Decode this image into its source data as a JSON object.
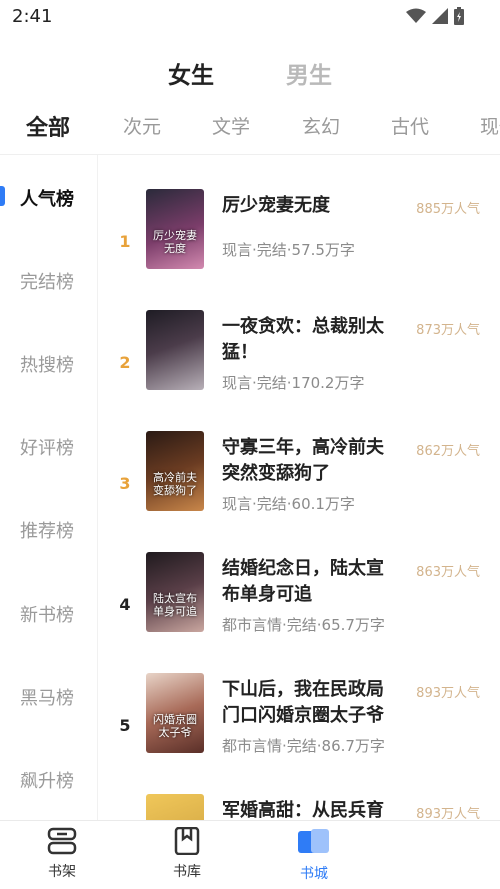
{
  "status_bar": {
    "time": "2:41"
  },
  "gender_tabs": [
    {
      "label": "女生",
      "active": true
    },
    {
      "label": "男生",
      "active": false
    }
  ],
  "category_tabs": [
    "全部",
    "次元",
    "文学",
    "玄幻",
    "古代",
    "现代"
  ],
  "sidebar": {
    "items": [
      "人气榜",
      "完结榜",
      "热搜榜",
      "好评榜",
      "推荐榜",
      "新书榜",
      "黑马榜",
      "飙升榜"
    ],
    "active_index": 0
  },
  "books": [
    {
      "rank": "1",
      "title": "厉少宠妻无度",
      "meta": "现言·完结·57.5万字",
      "popularity": "885万人气",
      "cover_text": "厉少宠妻无度",
      "cover_color": "#6a3a5e"
    },
    {
      "rank": "2",
      "title": "一夜贪欢：总裁别太猛！",
      "meta": "现言·完结·170.2万字",
      "popularity": "873万人气",
      "cover_text": "",
      "cover_color": "#3b3440"
    },
    {
      "rank": "3",
      "title": "守寡三年，高冷前夫突然变舔狗了",
      "meta": "现言·完结·60.1万字",
      "popularity": "862万人气",
      "cover_text": "高冷前夫变舔狗了",
      "cover_color": "#5a3a2a"
    },
    {
      "rank": "4",
      "title": "结婚纪念日，陆太宣布单身可追",
      "meta": "都市言情·完结·65.7万字",
      "popularity": "863万人气",
      "cover_text": "陆太宣布单身可追",
      "cover_color": "#4a3a40"
    },
    {
      "rank": "5",
      "title": "下山后，我在民政局门口闪婚京圈太子爷",
      "meta": "都市言情·完结·86.7万字",
      "popularity": "893万人气",
      "cover_text": "闪婚京圈太子爷",
      "cover_color": "#8a5a4a"
    },
    {
      "rank": "",
      "title": "军婚高甜：从民兵育",
      "meta": "",
      "popularity": "893万人气",
      "cover_text": "",
      "cover_color": "#c79a3a"
    }
  ],
  "bottom_nav": [
    {
      "label": "书架",
      "icon": "bookshelf-icon",
      "active": false
    },
    {
      "label": "书库",
      "icon": "library-icon",
      "active": false
    },
    {
      "label": "书城",
      "icon": "bookstore-icon",
      "active": true
    }
  ],
  "colors": {
    "accent": "#2f7cf6",
    "rank_top": "#e8a23a",
    "popularity": "#d3b48d"
  }
}
